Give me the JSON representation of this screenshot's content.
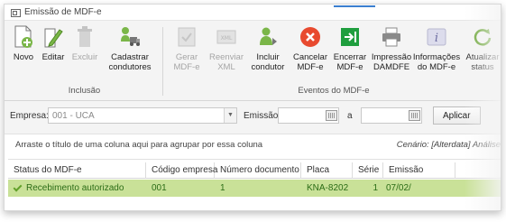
{
  "window": {
    "title": "Emissão de MDF-e"
  },
  "toolbar": {
    "buttons": [
      {
        "label1": "Novo",
        "label2": "",
        "icon": "new-document-icon"
      },
      {
        "label1": "Editar",
        "label2": "",
        "icon": "edit-pencil-icon"
      },
      {
        "label1": "Excluir",
        "label2": "",
        "icon": "trash-icon"
      },
      {
        "label1": "Cadastrar",
        "label2": "condutores",
        "icon": "drivers-truck-icon"
      },
      {
        "label1": "Gerar",
        "label2": "MDF-e",
        "icon": "generate-document-icon"
      },
      {
        "label1": "Reenviar",
        "label2": "XML",
        "icon": "resend-xml-icon"
      },
      {
        "label1": "Incluir",
        "label2": "condutor",
        "icon": "add-driver-icon"
      },
      {
        "label1": "Cancelar",
        "label2": "MDF-e",
        "icon": "cancel-icon"
      },
      {
        "label1": "Encerrar",
        "label2": "MDF-e",
        "icon": "close-mdfe-icon"
      },
      {
        "label1": "Impressão",
        "label2": "DAMDFE",
        "icon": "printer-icon"
      },
      {
        "label1": "Informações",
        "label2": "do MDF-e",
        "icon": "info-icon"
      },
      {
        "label1": "Atualizar",
        "label2": "status",
        "icon": "refresh-icon"
      }
    ],
    "groups": {
      "inclusao": "Inclusão",
      "eventos": "Eventos do MDF-e"
    }
  },
  "filters": {
    "empresa_label": "Empresa:",
    "empresa_value": "001 - UCA",
    "emissao_label": "Emissão:",
    "date_sep": "a",
    "apply_label": "Aplicar"
  },
  "grid": {
    "group_hint": "Arraste o título de uma coluna aqui para agrupar por essa coluna",
    "scenario": "Cenário: [Alterdata] Análise",
    "columns": [
      "Status do MDF-e",
      "Código empresa",
      "Número documento",
      "Placa",
      "Série",
      "Emissão"
    ],
    "rows": [
      {
        "status": "Recebimento autorizado",
        "codigo": "001",
        "numero": "1",
        "placa": "KNA-8202",
        "serie": "1",
        "emissao": "07/02/"
      }
    ]
  },
  "colors": {
    "accent_blue": "#3b7fd0",
    "new_green": "#7ab648",
    "cancel_red": "#e84a2f",
    "close_green": "#1f9e3e",
    "row_selected": "#c9e198",
    "row_text": "#2b6c16"
  }
}
